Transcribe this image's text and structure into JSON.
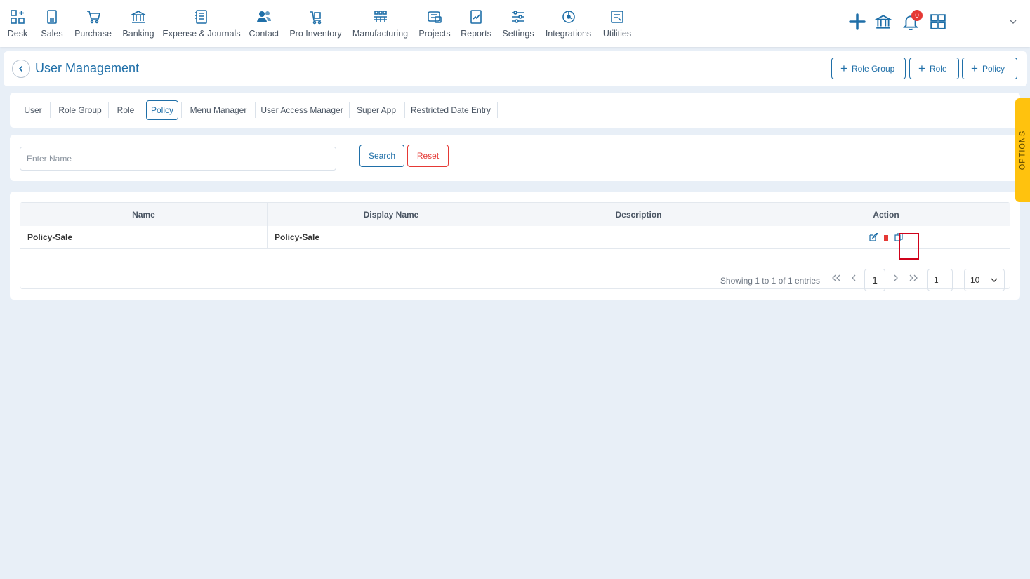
{
  "nav": {
    "items": [
      {
        "label": "Desk",
        "icon": "desk-icon"
      },
      {
        "label": "Sales",
        "icon": "sales-icon"
      },
      {
        "label": "Purchase",
        "icon": "cart-icon"
      },
      {
        "label": "Banking",
        "icon": "bank-icon"
      },
      {
        "label": "Expense & Journals",
        "icon": "journal-icon"
      },
      {
        "label": "Contact",
        "icon": "contact-icon"
      },
      {
        "label": "Pro Inventory",
        "icon": "inventory-icon"
      },
      {
        "label": "Manufacturing",
        "icon": "manufacturing-icon"
      },
      {
        "label": "Projects",
        "icon": "projects-icon"
      },
      {
        "label": "Reports",
        "icon": "reports-icon"
      },
      {
        "label": "Settings",
        "icon": "settings-icon"
      },
      {
        "label": "Integrations",
        "icon": "integrations-icon"
      },
      {
        "label": "Utilities",
        "icon": "utilities-icon"
      }
    ],
    "notification_count": "0"
  },
  "header": {
    "title": "User Management",
    "buttons": [
      "Role Group",
      "Role",
      "Policy"
    ]
  },
  "tabs": [
    {
      "label": "User"
    },
    {
      "label": "Role Group"
    },
    {
      "label": "Role"
    },
    {
      "label": "Policy",
      "active": true
    },
    {
      "label": "Menu Manager"
    },
    {
      "label": "User Access Manager"
    },
    {
      "label": "Super App"
    },
    {
      "label": "Restricted Date Entry"
    }
  ],
  "search": {
    "placeholder": "Enter Name",
    "value": "",
    "search_label": "Search",
    "reset_label": "Reset"
  },
  "table": {
    "columns": [
      "Name",
      "Display Name",
      "Description",
      "Action"
    ],
    "rows": [
      {
        "name": "Policy-Sale",
        "display_name": "Policy-Sale",
        "description": ""
      }
    ]
  },
  "pagination": {
    "info": "Showing 1 to 1 of 1 entries",
    "current_page": "1",
    "goto_page": "1",
    "page_size": "10"
  },
  "options_label": "OPTIONS",
  "colors": {
    "accent": "#1f6fa8",
    "danger": "#e53935",
    "options": "#ffc20e",
    "background": "#e8eff7"
  }
}
